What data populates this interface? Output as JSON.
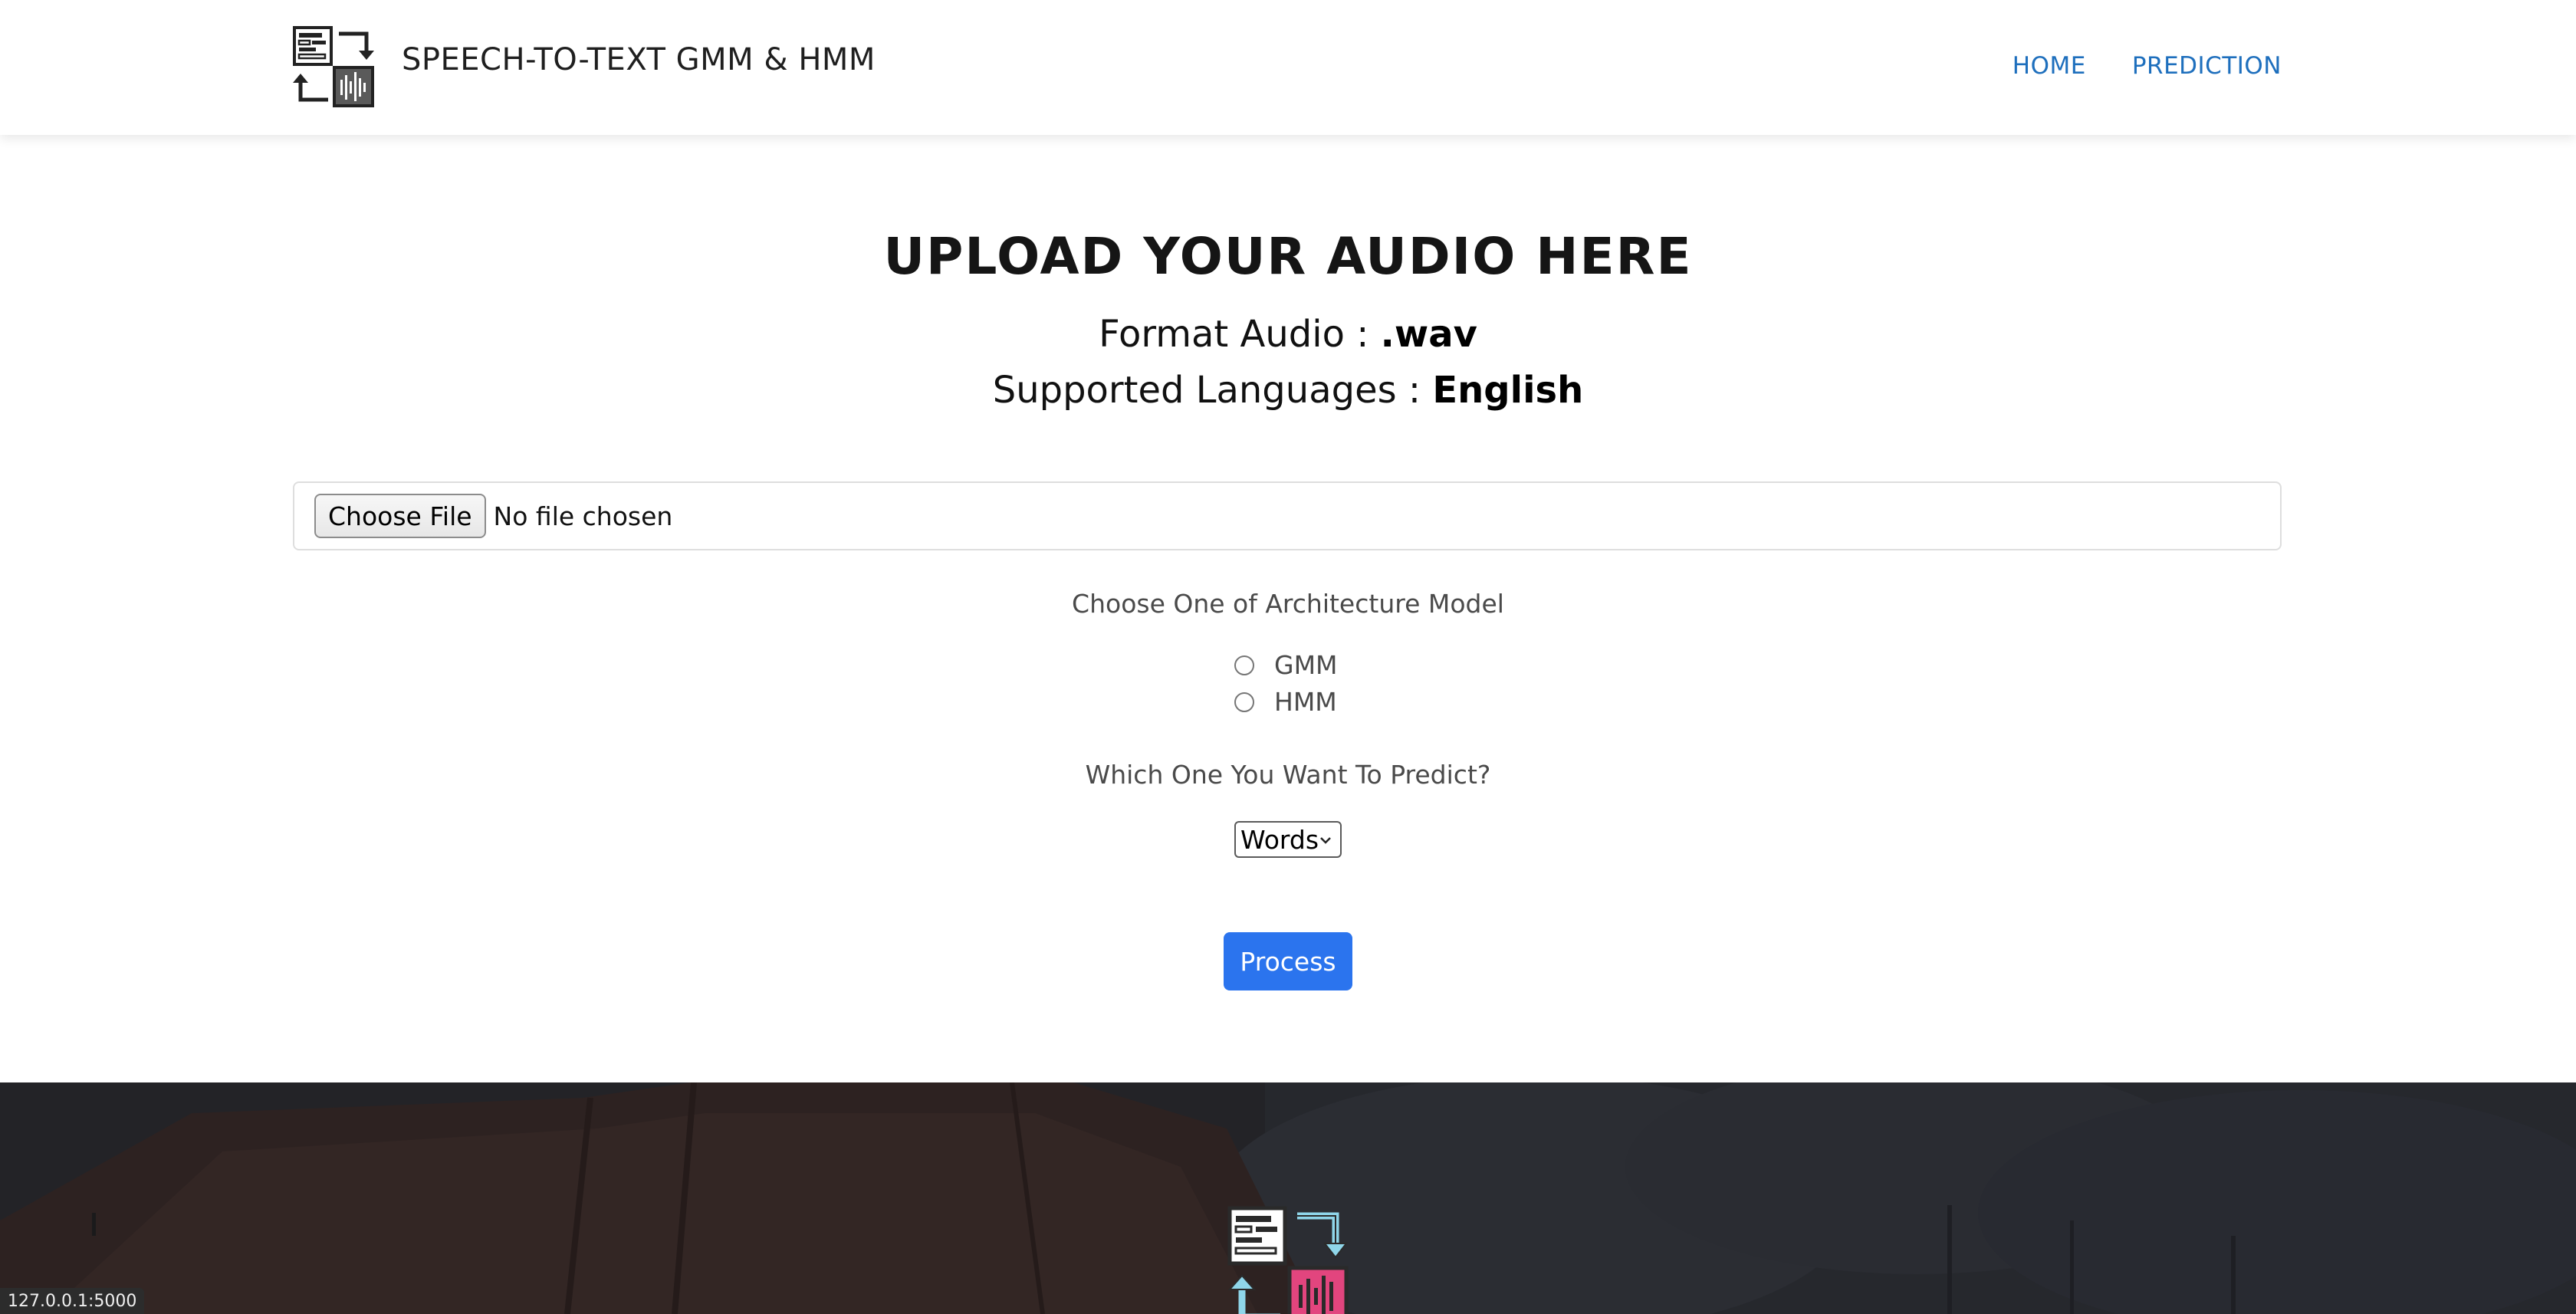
{
  "header": {
    "brand_name": "SPEECH-TO-TEXT GMM & HMM",
    "nav": {
      "home": "HOME",
      "prediction": "PREDICTION"
    }
  },
  "main": {
    "title": "UPLOAD YOUR AUDIO HERE",
    "format_prefix": "Format Audio : ",
    "format_value": ".wav",
    "languages_prefix": "Supported Languages : ",
    "languages_value": "English",
    "file_input": {
      "button_label": "Choose File",
      "status": "No file chosen"
    },
    "architecture": {
      "label": "Choose One of Architecture Model",
      "options": [
        "GMM",
        "HMM"
      ],
      "selected": null
    },
    "predict": {
      "label": "Which One You Want To Predict?",
      "selected_option": "Words"
    },
    "process_button": "Process"
  },
  "status_bar": {
    "url": "127.0.0.1:5000"
  },
  "colors": {
    "nav_link": "#1e6fbd",
    "primary_button": "#2b74ee",
    "logo_pink": "#e2457e",
    "logo_cyan": "#8fd6ea",
    "footer_dark": "#2a2b2f"
  },
  "icons": {
    "brand_logo": "speech-to-text-logo-icon",
    "footer_logo": "speech-to-text-logo-icon",
    "select_chevron": "chevron-down-icon"
  }
}
